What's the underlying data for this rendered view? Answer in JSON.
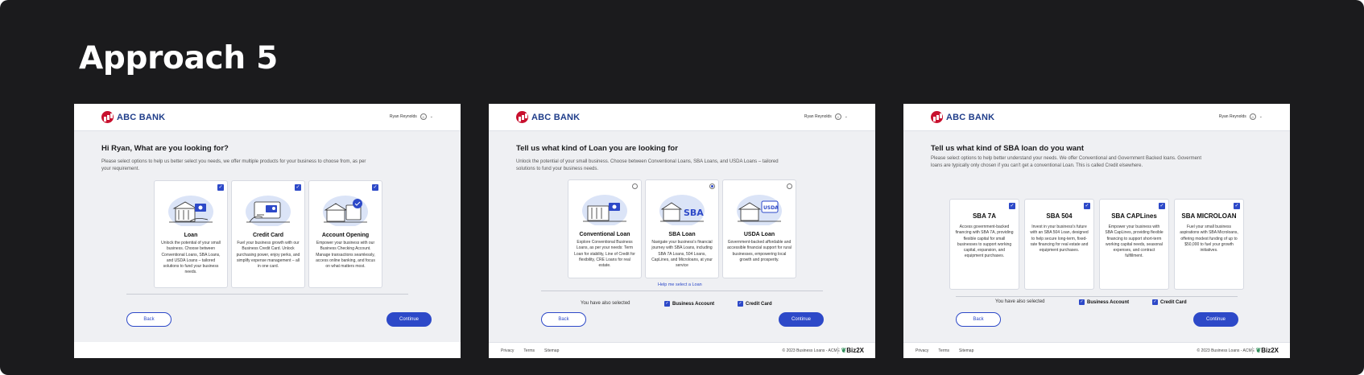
{
  "heading": "Approach 5",
  "brand": {
    "name": "ABC BANK",
    "user": "Ryan Reynolds"
  },
  "screens": [
    {
      "title": "Hi Ryan, What are you looking for?",
      "subtitle": "Please select options to help us better select you needs, we offer multiple products for your business to choose from, as per your requirement.",
      "cards": [
        {
          "title": "Loan",
          "desc": "Unlock the potential of your small business. Choose between Conventional Loans, SBA Loans, and USDA Loans – tailored solutions to fund your business needs."
        },
        {
          "title": "Credit Card",
          "desc": "Fuel your business growth with our Business Credit Card. Unlock purchasing power, enjoy perks, and simplify expense management – all in one card."
        },
        {
          "title": "Account Opening",
          "desc": "Empower your business with our Business Checking Account. Manage transactions seamlessly, access online banking, and focus on what matters most."
        }
      ],
      "back": "Back",
      "continue": "Continue"
    },
    {
      "title": "Tell us what kind of Loan you are looking for",
      "subtitle": "Unlock the potential of your small business. Choose between Conventional Loans, SBA Loans, and USDA Loans – tailored solutions to fund your business needs.",
      "cards": [
        {
          "title": "Conventional Loan",
          "desc": "Explore Conventional Business Loans, as per your needs: Term Loan for stability, Line of Credit for flexibility, CRE Loans for real estate."
        },
        {
          "title": "SBA Loan",
          "desc": "Navigate your business's financial journey with SBA Loans, including SBA 7A Loans, 504 Loans, CapLines, and Microloans, at your service"
        },
        {
          "title": "USDA Loan",
          "desc": "Government-backed affordable and accessible financial support for rural businesses, empowering local growth and prosperity."
        }
      ],
      "help": "Help me select a Loan",
      "also": "You have also selected",
      "also_items": [
        "Business Account",
        "Credit Card"
      ],
      "back": "Back",
      "continue": "Continue",
      "footer": {
        "links": [
          "Privacy",
          "Terms",
          "Sitemap"
        ],
        "copy": "© 2023 Business Loans - ACME",
        "biz": "Biz2X"
      }
    },
    {
      "title": "Tell us what kind of SBA loan do you want",
      "subtitle": "Please select options to help better understand your needs. We offer Conventional and Government Backed loans. Goverment loans are typically only chosen if you can't get a conventional Loan. This is called Credit elsewhere.",
      "cards": [
        {
          "title": "SBA 7A",
          "desc": "Access government-backed financing with SBA 7A, providing flexible capital for small businesses to support working capital, expansion, and equipment purchases."
        },
        {
          "title": "SBA 504",
          "desc": "Invest in your business's future with an SBA 504 Loan, designed to help secure long-term, fixed-rate financing for real estate and equipment purchases."
        },
        {
          "title": "SBA CAPLines",
          "desc": "Empower your business with SBA CapLines, providing flexible financing to support short-term working capital needs, seasonal expenses, and contract fulfillment."
        },
        {
          "title": "SBA MICROLOAN",
          "desc": "Fuel your small business aspirations with SBA Microloans, offering modest funding of up to $50,000 to fuel your growth initiatives."
        }
      ],
      "also": "You have also selected",
      "also_items": [
        "Business Account",
        "Credit Card"
      ],
      "back": "Back",
      "continue": "Continue",
      "footer": {
        "links": [
          "Privacy",
          "Terms",
          "Sitemap"
        ],
        "copy": "© 2023 Business Loans - ACME",
        "biz": "Biz2X"
      }
    }
  ],
  "colors": {
    "accent": "#2d49c8",
    "brand": "#1f3d8a",
    "logo_red": "#c8102e",
    "stage": "#1b1b1d",
    "screen_bg": "#eff0f3"
  }
}
